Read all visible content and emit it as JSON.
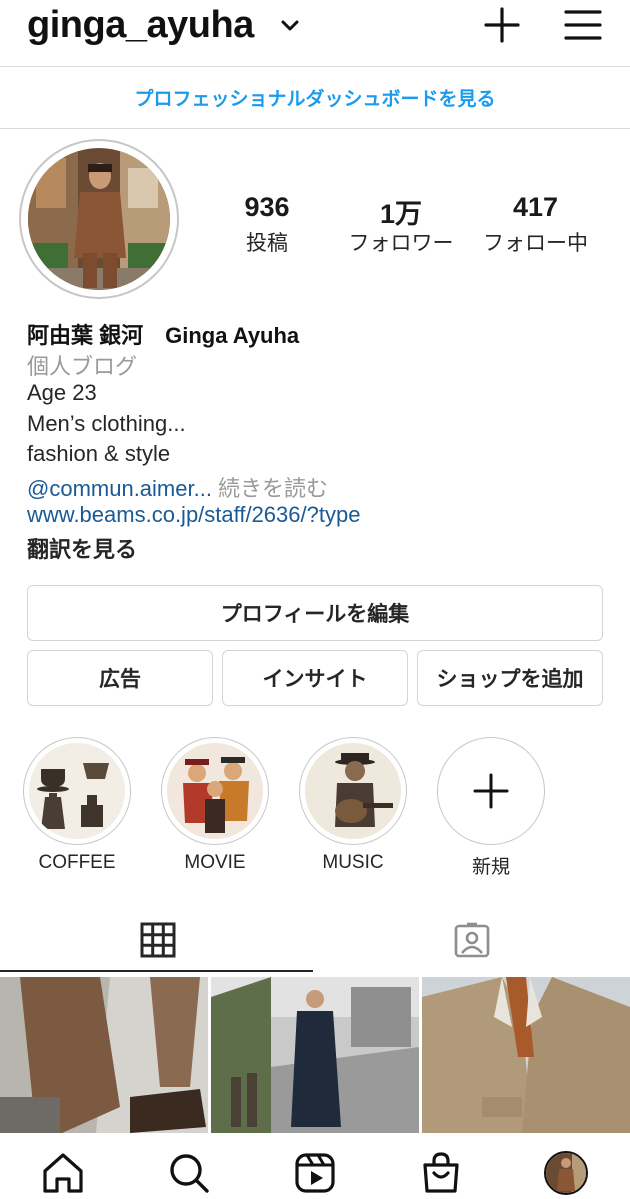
{
  "header": {
    "username": "ginga_ayuha",
    "icons": [
      "chevron-down-icon",
      "plus-icon",
      "menu-icon"
    ]
  },
  "dashboard_link": "プロフェッショナルダッシュボードを見る",
  "stats": {
    "posts": {
      "value": "936",
      "label": "投稿"
    },
    "followers": {
      "value": "1万",
      "label": "フォロワー"
    },
    "following": {
      "value": "417",
      "label": "フォロー中"
    }
  },
  "bio": {
    "name": "阿由葉 銀河　Ginga Ayuha",
    "category": "個人ブログ",
    "lines": [
      "Age 23",
      "Men’s clothing...",
      "fashion & style"
    ],
    "mention": "@commun.aimer...",
    "read_more": " 続きを読む",
    "url": "www.beams.co.jp/staff/2636/?type",
    "translate": "翻訳を見る"
  },
  "buttons": {
    "edit_profile": "プロフィールを編集",
    "ads": "広告",
    "insights": "インサイト",
    "add_shop": "ショップを追加"
  },
  "highlights": [
    {
      "label": "COFFEE"
    },
    {
      "label": "MOVIE"
    },
    {
      "label": "MUSIC"
    },
    {
      "label": "新規"
    }
  ],
  "tabs": [
    "grid-icon",
    "tagged-icon"
  ],
  "nav": [
    "home-icon",
    "search-icon",
    "reels-icon",
    "shop-icon",
    "profile-avatar"
  ],
  "colors": {
    "link_blue": "#1a9bef",
    "bio_link": "#1b5a95",
    "border": "#dbdbdb"
  }
}
